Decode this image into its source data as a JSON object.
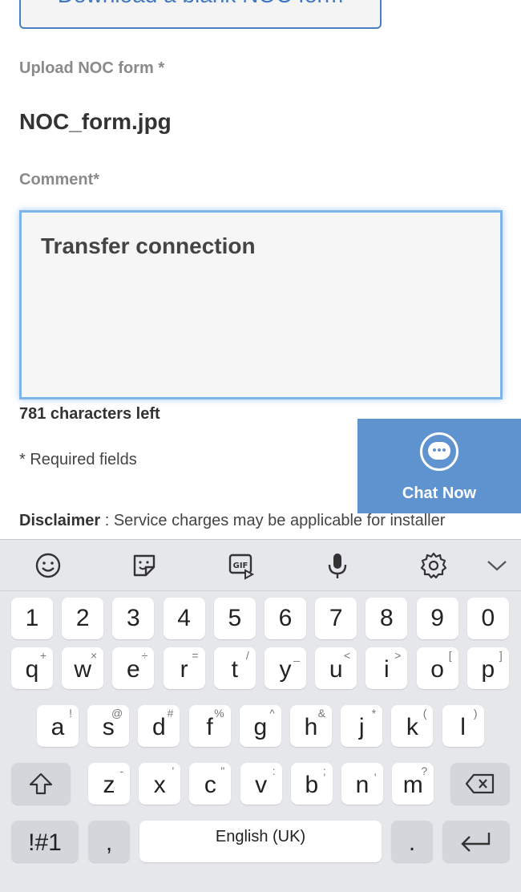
{
  "form": {
    "download_button": "Download a blank NOC form",
    "upload_label": "Upload NOC form *",
    "file_name": "NOC_form.jpg",
    "comment_label": "Comment*",
    "comment_value": "Transfer connection",
    "chars_left": "781 characters left",
    "required_note": "* Required fields",
    "disclaimer_label": "Disclaimer",
    "disclaimer_text": " : Service charges may be applicable for installer"
  },
  "chat": {
    "label": "Chat Now",
    "icon": "chat-bubble-icon",
    "color": "#5f93cf"
  },
  "keyboard": {
    "toolbar": [
      "emoji-icon",
      "sticker-icon",
      "gif-icon",
      "microphone-icon",
      "settings-icon",
      "collapse-chevron-icon"
    ],
    "numbers": [
      "1",
      "2",
      "3",
      "4",
      "5",
      "6",
      "7",
      "8",
      "9",
      "0"
    ],
    "row1": [
      [
        "q",
        "+"
      ],
      [
        "w",
        "×"
      ],
      [
        "e",
        "÷"
      ],
      [
        "r",
        "="
      ],
      [
        "t",
        "/"
      ],
      [
        "y",
        "_"
      ],
      [
        "u",
        "<"
      ],
      [
        "i",
        ">"
      ],
      [
        "o",
        "["
      ],
      [
        "p",
        "]"
      ]
    ],
    "row2": [
      [
        "a",
        "!"
      ],
      [
        "s",
        "@"
      ],
      [
        "d",
        "#"
      ],
      [
        "f",
        "%"
      ],
      [
        "g",
        "^"
      ],
      [
        "h",
        "&"
      ],
      [
        "j",
        "*"
      ],
      [
        "k",
        "("
      ],
      [
        "l",
        ")"
      ]
    ],
    "row3": [
      [
        "z",
        "-"
      ],
      [
        "x",
        "'"
      ],
      [
        "c",
        "\""
      ],
      [
        "v",
        ":"
      ],
      [
        "b",
        ";"
      ],
      [
        "n",
        ","
      ],
      [
        "m",
        "?"
      ]
    ],
    "symbols_key": "!#1",
    "comma_key": ",",
    "space_label": "English (UK)",
    "period_key": "."
  }
}
